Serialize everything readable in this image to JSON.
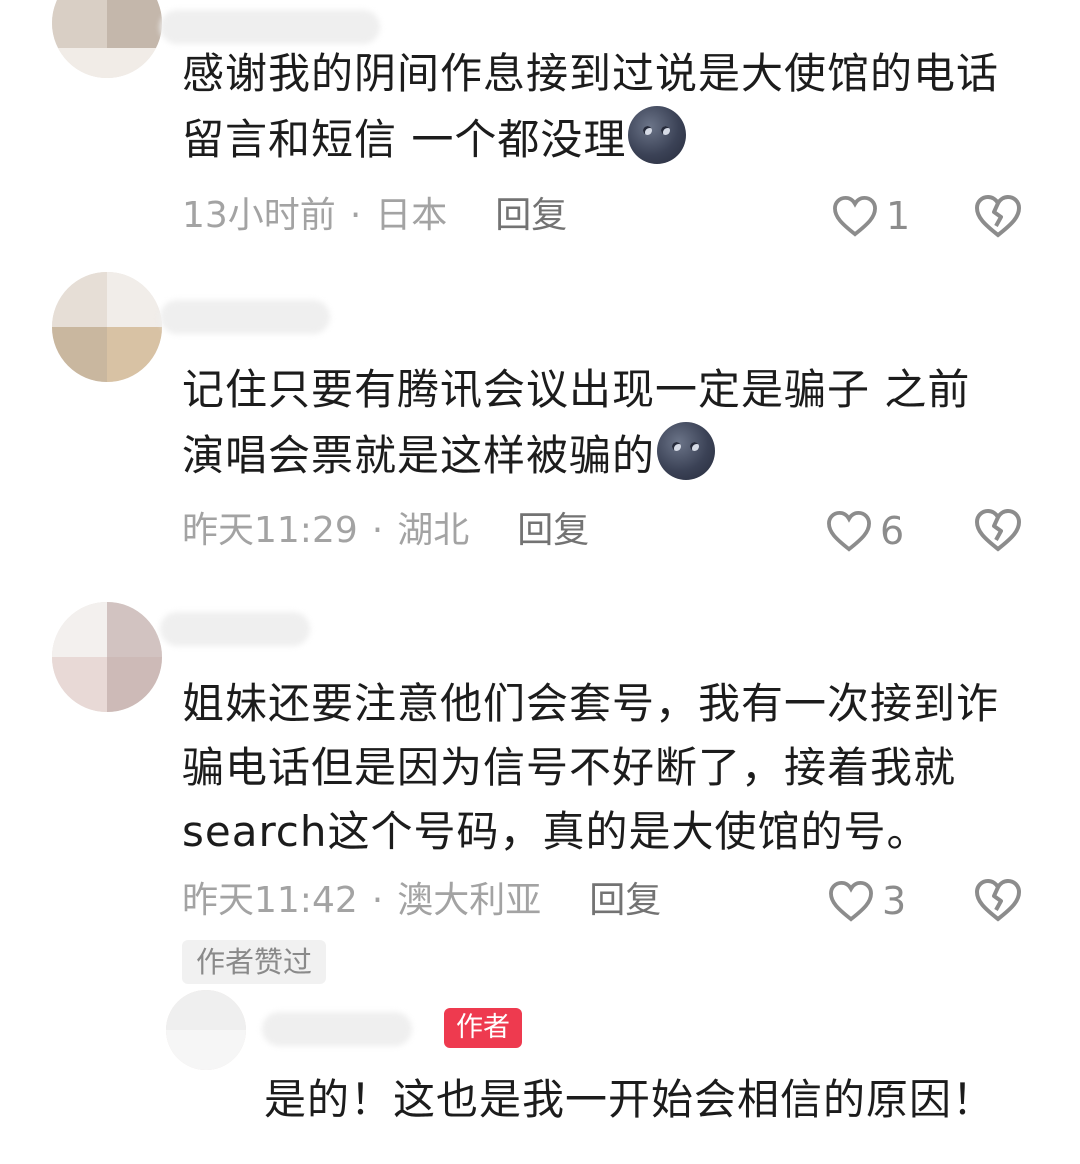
{
  "comments": [
    {
      "text": "感谢我的阴间作息接到过说是大使馆的电话留言和短信 一个都没理",
      "emoji": "new-moon-face",
      "time": "13小时前",
      "location": "日本",
      "reply_label": "回复",
      "likes": "1"
    },
    {
      "text": "记住只要有腾讯会议出现一定是骗子 之前演唱会票就是这样被骗的",
      "emoji": "new-moon-face",
      "time": "昨天11:29",
      "location": "湖北",
      "reply_label": "回复",
      "likes": "6"
    },
    {
      "text": "姐妹还要注意他们会套号，我有一次接到诈骗电话但是因为信号不好断了，接着我就search这个号码，真的是大使馆的号。",
      "time": "昨天11:42",
      "location": "澳大利亚",
      "reply_label": "回复",
      "likes": "3",
      "liked_by_author_label": "作者赞过"
    }
  ],
  "author_reply": {
    "author_tag": "作者",
    "text": "是的！这也是我一开始会相信的原因！"
  },
  "colors": {
    "author_tag": "#ee3a4f",
    "meta_text": "#a3a3a3",
    "icon": "#8c8c8c"
  },
  "icons": {
    "like": "heart-outline-icon",
    "dislike": "broken-heart-icon"
  }
}
